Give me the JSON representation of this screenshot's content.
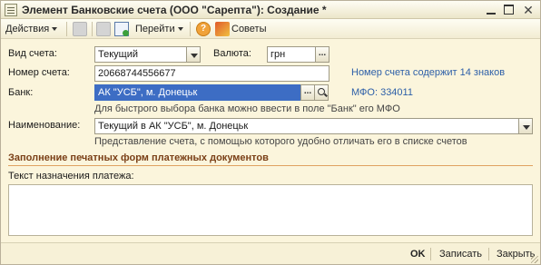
{
  "window": {
    "title": "Элемент Банковские счета (ООО \"Сарепта\"): Создание *"
  },
  "toolbar": {
    "actions_label": "Действия",
    "goto_label": "Перейти",
    "tips_label": "Советы"
  },
  "form": {
    "account_type_label": "Вид счета:",
    "account_type_value": "Текущий",
    "currency_label": "Валюта:",
    "currency_value": "грн",
    "account_number_label": "Номер счета:",
    "account_number_value": "20668744556677",
    "account_number_note": "Номер счета содержит 14 знаков",
    "bank_label": "Банк:",
    "bank_value": "АК \"УСБ\", м. Донецьк",
    "mfo_text": "МФО: 334011",
    "bank_hint": "Для быстрого выбора банка можно ввести в поле \"Банк\" его МФО",
    "name_label": "Наименование:",
    "name_value": "Текущий в АК \"УСБ\", м. Донецьк",
    "name_hint": "Представление счета, с помощью которого удобно отличать его в списке счетов"
  },
  "section": {
    "title": "Заполнение печатных форм платежных документов",
    "payment_purpose_label": "Текст назначения платежа:",
    "payment_purpose_value": ""
  },
  "footer": {
    "ok_label": "OK",
    "save_label": "Записать",
    "close_label": "Закрыть"
  }
}
